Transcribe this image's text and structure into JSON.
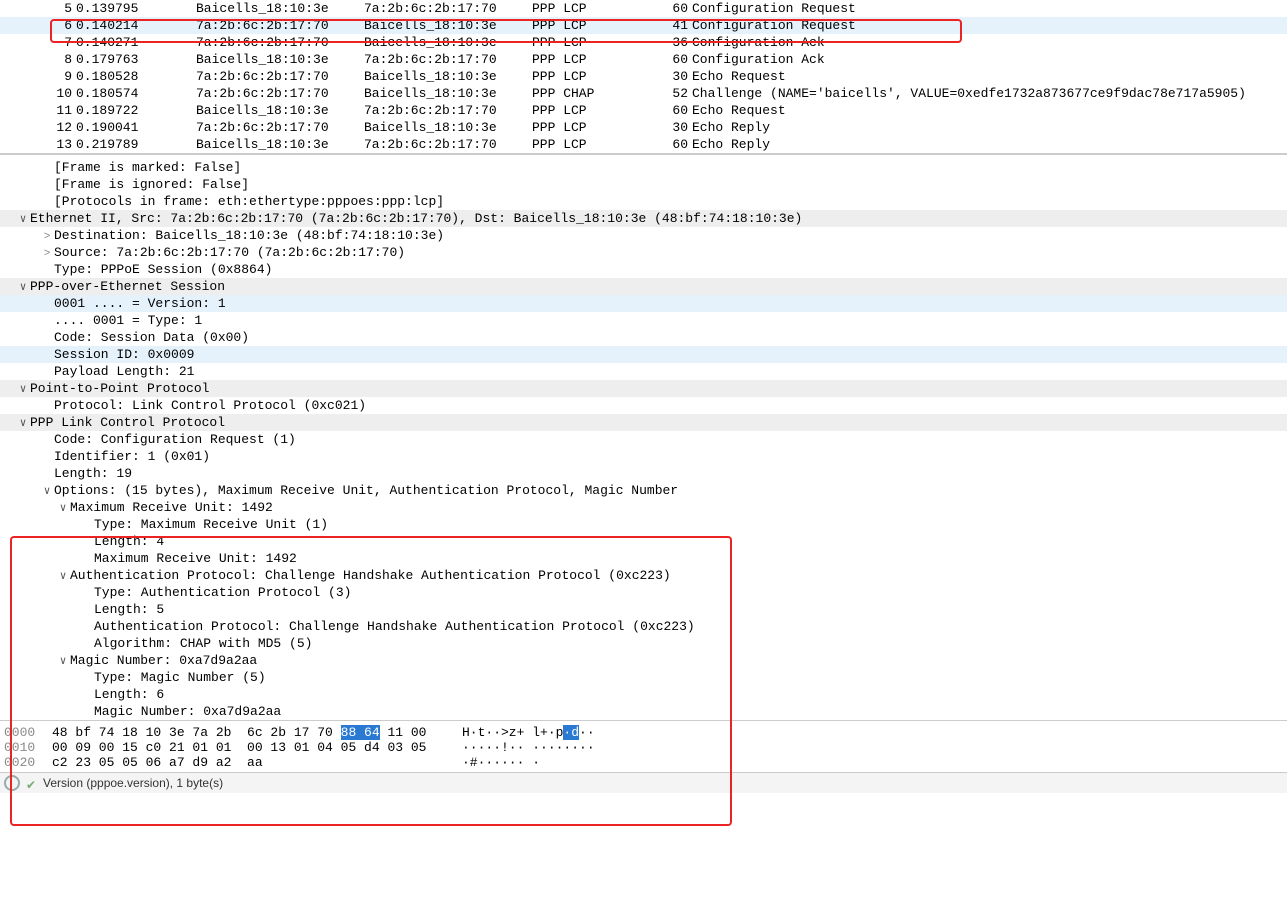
{
  "packets": [
    {
      "no": "5",
      "time": "0.139795",
      "src": "Baicells_18:10:3e",
      "dst": "7a:2b:6c:2b:17:70",
      "proto": "PPP LCP",
      "len": "60",
      "info": "Configuration Request",
      "selected": false
    },
    {
      "no": "6",
      "time": "0.140214",
      "src": "7a:2b:6c:2b:17:70",
      "dst": "Baicells_18:10:3e",
      "proto": "PPP LCP",
      "len": "41",
      "info": "Configuration Request",
      "selected": true
    },
    {
      "no": "7",
      "time": "0.140271",
      "src": "7a:2b:6c:2b:17:70",
      "dst": "Baicells_18:10:3e",
      "proto": "PPP LCP",
      "len": "36",
      "info": "Configuration Ack"
    },
    {
      "no": "8",
      "time": "0.179763",
      "src": "Baicells_18:10:3e",
      "dst": "7a:2b:6c:2b:17:70",
      "proto": "PPP LCP",
      "len": "60",
      "info": "Configuration Ack"
    },
    {
      "no": "9",
      "time": "0.180528",
      "src": "7a:2b:6c:2b:17:70",
      "dst": "Baicells_18:10:3e",
      "proto": "PPP LCP",
      "len": "30",
      "info": "Echo Request"
    },
    {
      "no": "10",
      "time": "0.180574",
      "src": "7a:2b:6c:2b:17:70",
      "dst": "Baicells_18:10:3e",
      "proto": "PPP CHAP",
      "len": "52",
      "info": "Challenge (NAME='baicells', VALUE=0xedfe1732a873677ce9f9dac78e717a5905)"
    },
    {
      "no": "11",
      "time": "0.189722",
      "src": "Baicells_18:10:3e",
      "dst": "7a:2b:6c:2b:17:70",
      "proto": "PPP LCP",
      "len": "60",
      "info": "Echo Request"
    },
    {
      "no": "12",
      "time": "0.190041",
      "src": "7a:2b:6c:2b:17:70",
      "dst": "Baicells_18:10:3e",
      "proto": "PPP LCP",
      "len": "30",
      "info": "Echo Reply"
    },
    {
      "no": "13",
      "time": "0.219789",
      "src": "Baicells_18:10:3e",
      "dst": "7a:2b:6c:2b:17:70",
      "proto": "PPP LCP",
      "len": "60",
      "info": "Echo Reply"
    }
  ],
  "details": [
    {
      "indent": "i1",
      "arrow": "none",
      "text": "[Frame is marked: False]"
    },
    {
      "indent": "i1",
      "arrow": "none",
      "text": "[Frame is ignored: False]"
    },
    {
      "indent": "i1",
      "arrow": "none",
      "text": "[Protocols in frame: eth:ethertype:pppoes:ppp:lcp]"
    },
    {
      "indent": "i0",
      "arrow": "down",
      "text": "Ethernet II, Src: 7a:2b:6c:2b:17:70 (7a:2b:6c:2b:17:70), Dst: Baicells_18:10:3e (48:bf:74:18:10:3e)",
      "alt": true
    },
    {
      "indent": "i1",
      "arrow": "right",
      "text": "Destination: Baicells_18:10:3e (48:bf:74:18:10:3e)"
    },
    {
      "indent": "i1",
      "arrow": "right",
      "text": "Source: 7a:2b:6c:2b:17:70 (7a:2b:6c:2b:17:70)"
    },
    {
      "indent": "i1",
      "arrow": "none",
      "text": "Type: PPPoE Session (0x8864)"
    },
    {
      "indent": "i0",
      "arrow": "down",
      "text": "PPP-over-Ethernet Session",
      "alt": true
    },
    {
      "indent": "i1",
      "arrow": "none",
      "text": "0001 .... = Version: 1",
      "sel": true
    },
    {
      "indent": "i1",
      "arrow": "none",
      "text": ".... 0001 = Type: 1"
    },
    {
      "indent": "i1",
      "arrow": "none",
      "text": "Code: Session Data (0x00)"
    },
    {
      "indent": "i1",
      "arrow": "none",
      "text": "Session ID: 0x0009",
      "sel": true
    },
    {
      "indent": "i1",
      "arrow": "none",
      "text": "Payload Length: 21"
    },
    {
      "indent": "i0",
      "arrow": "down",
      "text": "Point-to-Point Protocol",
      "alt": true
    },
    {
      "indent": "i1",
      "arrow": "none",
      "text": "Protocol: Link Control Protocol (0xc021)"
    },
    {
      "indent": "i0",
      "arrow": "down",
      "text": "PPP Link Control Protocol",
      "alt": true
    },
    {
      "indent": "i1",
      "arrow": "none",
      "text": "Code: Configuration Request (1)"
    },
    {
      "indent": "i1",
      "arrow": "none",
      "text": "Identifier: 1 (0x01)"
    },
    {
      "indent": "i1",
      "arrow": "none",
      "text": "Length: 19"
    },
    {
      "indent": "i1",
      "arrow": "down",
      "text": "Options: (15 bytes), Maximum Receive Unit, Authentication Protocol, Magic Number"
    },
    {
      "indent": "i2",
      "arrow": "down",
      "text": "Maximum Receive Unit: 1492"
    },
    {
      "indent": "i4",
      "arrow": "none",
      "text": "Type: Maximum Receive Unit (1)"
    },
    {
      "indent": "i4",
      "arrow": "none",
      "text": "Length: 4"
    },
    {
      "indent": "i4",
      "arrow": "none",
      "text": "Maximum Receive Unit: 1492"
    },
    {
      "indent": "i2",
      "arrow": "down",
      "text": "Authentication Protocol: Challenge Handshake Authentication Protocol (0xc223)"
    },
    {
      "indent": "i4",
      "arrow": "none",
      "text": "Type: Authentication Protocol (3)"
    },
    {
      "indent": "i4",
      "arrow": "none",
      "text": "Length: 5"
    },
    {
      "indent": "i4",
      "arrow": "none",
      "text": "Authentication Protocol: Challenge Handshake Authentication Protocol (0xc223)"
    },
    {
      "indent": "i4",
      "arrow": "none",
      "text": "Algorithm: CHAP with MD5 (5)"
    },
    {
      "indent": "i2",
      "arrow": "down",
      "text": "Magic Number: 0xa7d9a2aa"
    },
    {
      "indent": "i4",
      "arrow": "none",
      "text": "Type: Magic Number (5)"
    },
    {
      "indent": "i4",
      "arrow": "none",
      "text": "Length: 6"
    },
    {
      "indent": "i4",
      "arrow": "none",
      "text": "Magic Number: 0xa7d9a2aa"
    }
  ],
  "hex": {
    "rows": [
      {
        "off": "0000",
        "b1": "48 bf 74 18 10 3e 7a 2b  6c 2b 17 70 ",
        "bhl": "88 64",
        "b2": " 11 00",
        "a1": "H·t··>z+ l+·p",
        "ahl": "·d",
        "a2": "··"
      },
      {
        "off": "0010",
        "b1": "00 09 00 15 c0 21 01 01  00 13 01 04 05 d4 03 05",
        "bhl": "",
        "b2": "",
        "a1": "·····!·· ········",
        "ahl": "",
        "a2": ""
      },
      {
        "off": "0020",
        "b1": "c2 23 05 05 06 a7 d9 a2  aa",
        "bhl": "",
        "b2": "",
        "a1": "·#······ ·",
        "ahl": "",
        "a2": ""
      }
    ]
  },
  "status": "Version (pppoe.version), 1 byte(s)"
}
